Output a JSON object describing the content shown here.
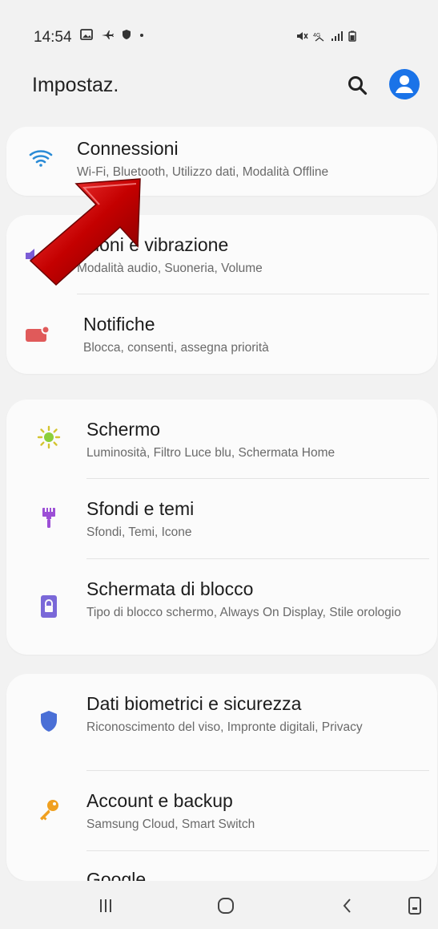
{
  "status_bar": {
    "time": "14:54",
    "left_icons": [
      "image-icon",
      "airplane-icon",
      "shield-icon",
      "dot-icon"
    ],
    "right_icons": [
      "mute-icon",
      "wifi-4g-icon",
      "signal-icon",
      "battery-icon"
    ]
  },
  "header": {
    "title": "Impostaz.",
    "search_icon": "search-icon",
    "profile_icon": "profile-icon",
    "accent": "#1a73e8"
  },
  "cards": [
    {
      "rows": [
        {
          "title": "Connessioni",
          "subtitle": "Wi-Fi, Bluetooth, Utilizzo dati, Modalità Offline",
          "icon": "wifi-icon",
          "icon_color": "#2a8bd6"
        }
      ]
    },
    {
      "rows": [
        {
          "title": "Suoni e vibrazione",
          "subtitle": "Modalità audio, Suoneria, Volume",
          "icon": "volume-icon",
          "icon_color": "#7b5cd6"
        },
        {
          "title": "Notifiche",
          "subtitle": "Blocca, consenti, assegna priorità",
          "icon": "notification-icon",
          "icon_color": "#e05a5a"
        }
      ]
    },
    {
      "rows": [
        {
          "title": "Schermo",
          "subtitle": "Luminosità, Filtro Luce blu, Schermata Home",
          "icon": "brightness-icon",
          "icon_color": "#8ccf3a"
        },
        {
          "title": "Sfondi e temi",
          "subtitle": "Sfondi, Temi, Icone",
          "icon": "brush-icon",
          "icon_color": "#9c4fd6"
        },
        {
          "title": "Schermata di blocco",
          "subtitle": "Tipo di blocco schermo, Always On Display, Stile orologio",
          "icon": "lock-icon",
          "icon_color": "#7a68d8"
        }
      ]
    },
    {
      "rows": [
        {
          "title": "Dati biometrici e sicurezza",
          "subtitle": "Riconoscimento del viso, Impronte digitali, Privacy",
          "icon": "shield-icon",
          "icon_color": "#4a6fd6"
        },
        {
          "title": "Account e backup",
          "subtitle": "Samsung Cloud, Smart Switch",
          "icon": "key-icon",
          "icon_color": "#f0a020"
        },
        {
          "title": "Google",
          "subtitle": "",
          "icon": "google-icon",
          "icon_color": "#4285f4"
        }
      ]
    }
  ],
  "nav_bar": {
    "recents": "recents-icon",
    "home": "home-icon",
    "back": "back-icon",
    "screenshot": "screenshot-icon"
  },
  "annotation": {
    "arrow_color": "#c40000"
  }
}
